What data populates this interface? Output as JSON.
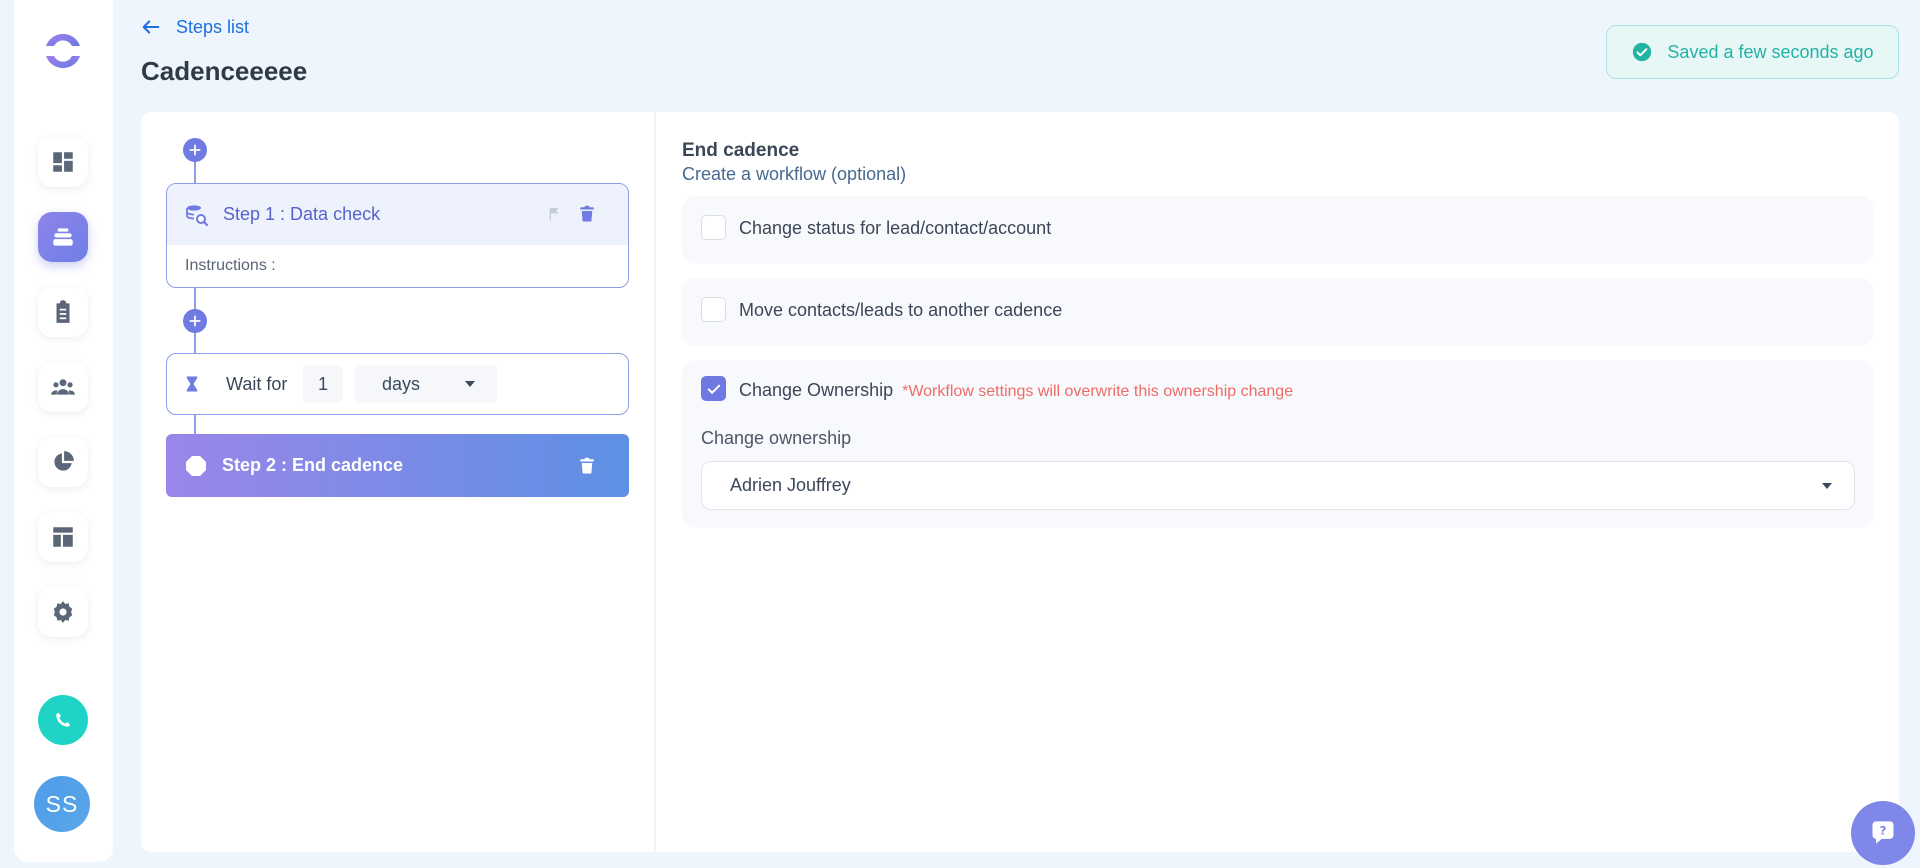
{
  "header": {
    "back_label": "Steps list",
    "title": "Cadenceeeee",
    "saved_status": "Saved a few seconds ago"
  },
  "sidebar": {
    "items": [
      {
        "name": "dashboard",
        "icon": "dashboard-icon"
      },
      {
        "name": "cadences",
        "icon": "stack-icon",
        "active": true
      },
      {
        "name": "tasks",
        "icon": "clipboard-icon"
      },
      {
        "name": "people",
        "icon": "people-icon"
      },
      {
        "name": "stats",
        "icon": "pie-chart-icon"
      },
      {
        "name": "templates",
        "icon": "layout-icon"
      },
      {
        "name": "settings",
        "icon": "gear-icon"
      }
    ],
    "avatar_initials": "SS"
  },
  "steps": {
    "step1_title": "Step 1 : Data check",
    "step1_instructions": "Instructions :",
    "wait_label": "Wait for",
    "wait_value": "1",
    "wait_unit": "days",
    "step2_title": "Step 2 : End cadence"
  },
  "workflow": {
    "title": "End cadence",
    "subtitle": "Create a workflow (optional)",
    "options": [
      {
        "label": "Change status for lead/contact/account",
        "checked": false
      },
      {
        "label": "Move contacts/leads to another cadence",
        "checked": false
      },
      {
        "label": "Change Ownership",
        "checked": true,
        "warning": "*Workflow settings will overwrite this ownership change"
      }
    ],
    "ownership_label": "Change ownership",
    "ownership_value": "Adrien Jouffrey"
  },
  "colors": {
    "accent": "#6f7be0",
    "link": "#1d6fe0",
    "success": "#22b3a5",
    "warning": "#ef6b67",
    "call": "#1fd3c6"
  }
}
